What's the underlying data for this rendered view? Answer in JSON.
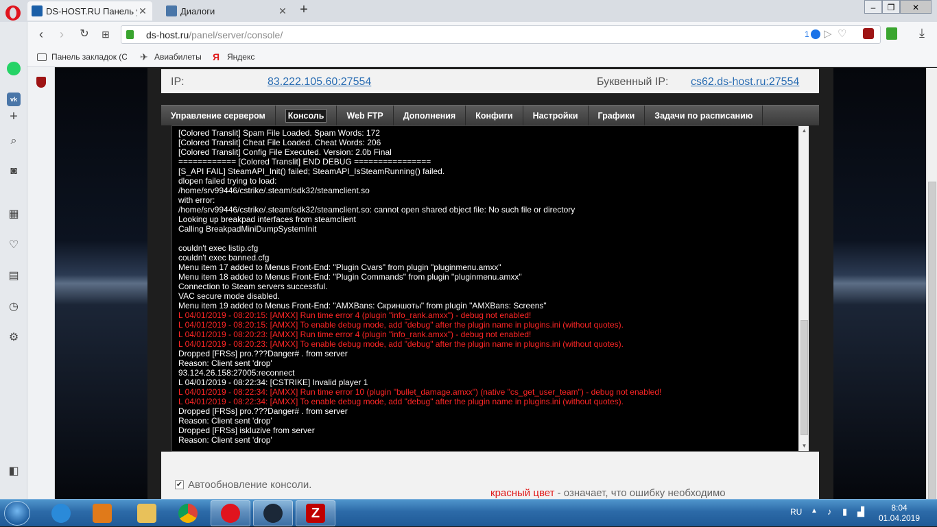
{
  "browser": {
    "tabs": [
      {
        "title": "DS-HOST.RU Панель упра",
        "active": true
      },
      {
        "title": "Диалоги",
        "active": false
      }
    ],
    "url_host": "ds-host.ru",
    "url_path": "/panel/server/console/",
    "addr_badge": "1",
    "bookmarks": [
      "Панель закладок (Ct",
      "Авиабилеты",
      "Яндекс"
    ]
  },
  "server": {
    "ip_label": "IP:",
    "ip_value": "83.222.105.60:27554",
    "letter_ip_label": "Буквенный IP:",
    "letter_ip_value": "cs62.ds-host.ru:27554"
  },
  "menu": [
    {
      "label": "Управление сервером",
      "active": false
    },
    {
      "label": "Консоль",
      "active": true
    },
    {
      "label": "Web FTP",
      "active": false
    },
    {
      "label": "Дополнения",
      "active": false
    },
    {
      "label": "Конфиги",
      "active": false
    },
    {
      "label": "Настройки",
      "active": false
    },
    {
      "label": "Графики",
      "active": false
    },
    {
      "label": "Задачи по расписанию",
      "active": false
    }
  ],
  "console_lines": [
    {
      "text": "[Colored Translit] Spam File Loaded. Spam Words: 172",
      "error": false
    },
    {
      "text": "[Colored Translit] Cheat File Loaded. Cheat Words: 206",
      "error": false
    },
    {
      "text": "[Colored Translit] Config File Executed. Version: 2.0b Final",
      "error": false
    },
    {
      "text": "============ [Colored Translit] END DEBUG ================",
      "error": false
    },
    {
      "text": "[S_API FAIL] SteamAPI_Init() failed; SteamAPI_IsSteamRunning() failed.",
      "error": false
    },
    {
      "text": "dlopen failed trying to load:",
      "error": false
    },
    {
      "text": "/home/srv99446/cstrike/.steam/sdk32/steamclient.so",
      "error": false
    },
    {
      "text": "with error:",
      "error": false
    },
    {
      "text": "/home/srv99446/cstrike/.steam/sdk32/steamclient.so: cannot open shared object file: No such file or directory",
      "error": false
    },
    {
      "text": "Looking up breakpad interfaces from steamclient",
      "error": false
    },
    {
      "text": "Calling BreakpadMiniDumpSystemInit",
      "error": false
    },
    {
      "text": "",
      "error": false
    },
    {
      "text": "couldn't exec listip.cfg",
      "error": false
    },
    {
      "text": "couldn't exec banned.cfg",
      "error": false
    },
    {
      "text": "Menu item 17 added to Menus Front-End: \"Plugin Cvars\" from plugin \"pluginmenu.amxx\"",
      "error": false
    },
    {
      "text": "Menu item 18 added to Menus Front-End: \"Plugin Commands\" from plugin \"pluginmenu.amxx\"",
      "error": false
    },
    {
      "text": "Connection to Steam servers successful.",
      "error": false
    },
    {
      "text": "VAC secure mode disabled.",
      "error": false
    },
    {
      "text": "Menu item 19 added to Menus Front-End: \"AMXBans: Скриншоты\" from plugin \"AMXBans: Screens\"",
      "error": false
    },
    {
      "text": "L 04/01/2019 - 08:20:15: [AMXX] Run time error 4 (plugin \"info_rank.amxx\") - debug not enabled!",
      "error": true
    },
    {
      "text": "L 04/01/2019 - 08:20:15: [AMXX] To enable debug mode, add \"debug\" after the plugin name in plugins.ini (without quotes).",
      "error": true
    },
    {
      "text": "L 04/01/2019 - 08:20:23: [AMXX] Run time error 4 (plugin \"info_rank.amxx\") - debug not enabled!",
      "error": true
    },
    {
      "text": "L 04/01/2019 - 08:20:23: [AMXX] To enable debug mode, add \"debug\" after the plugin name in plugins.ini (without quotes).",
      "error": true
    },
    {
      "text": "Dropped [FRSs] pro.???Danger# . from server",
      "error": false
    },
    {
      "text": "Reason: Client sent 'drop'",
      "error": false
    },
    {
      "text": "93.124.26.158:27005:reconnect",
      "error": false
    },
    {
      "text": "L 04/01/2019 - 08:22:34: [CSTRIKE] Invalid player 1",
      "error": false
    },
    {
      "text": "L 04/01/2019 - 08:22:34: [AMXX] Run time error 10 (plugin \"bullet_damage.amxx\") (native \"cs_get_user_team\") - debug not enabled!",
      "error": true
    },
    {
      "text": "L 04/01/2019 - 08:22:34: [AMXX] To enable debug mode, add \"debug\" after the plugin name in plugins.ini (without quotes).",
      "error": true
    },
    {
      "text": "Dropped [FRSs] pro.???Danger# . from server",
      "error": false
    },
    {
      "text": "Reason: Client sent 'drop'",
      "error": false
    },
    {
      "text": "Dropped [FRSs] iskluzive from server",
      "error": false
    },
    {
      "text": "Reason: Client sent 'drop'",
      "error": false
    }
  ],
  "footer": {
    "auto_update_label": "Автообновление консоли.",
    "auto_update_checked": true,
    "legend_red": "красный цвет",
    "legend_rest": " - означает, что ошибку необходимо"
  },
  "taskbar": {
    "lang": "RU",
    "time": "8:04",
    "date": "01.04.2019"
  },
  "colors": {
    "error_text": "#ff2626",
    "link": "#2a6db3",
    "console_bg": "#000000",
    "opera_red": "#e0141e"
  }
}
